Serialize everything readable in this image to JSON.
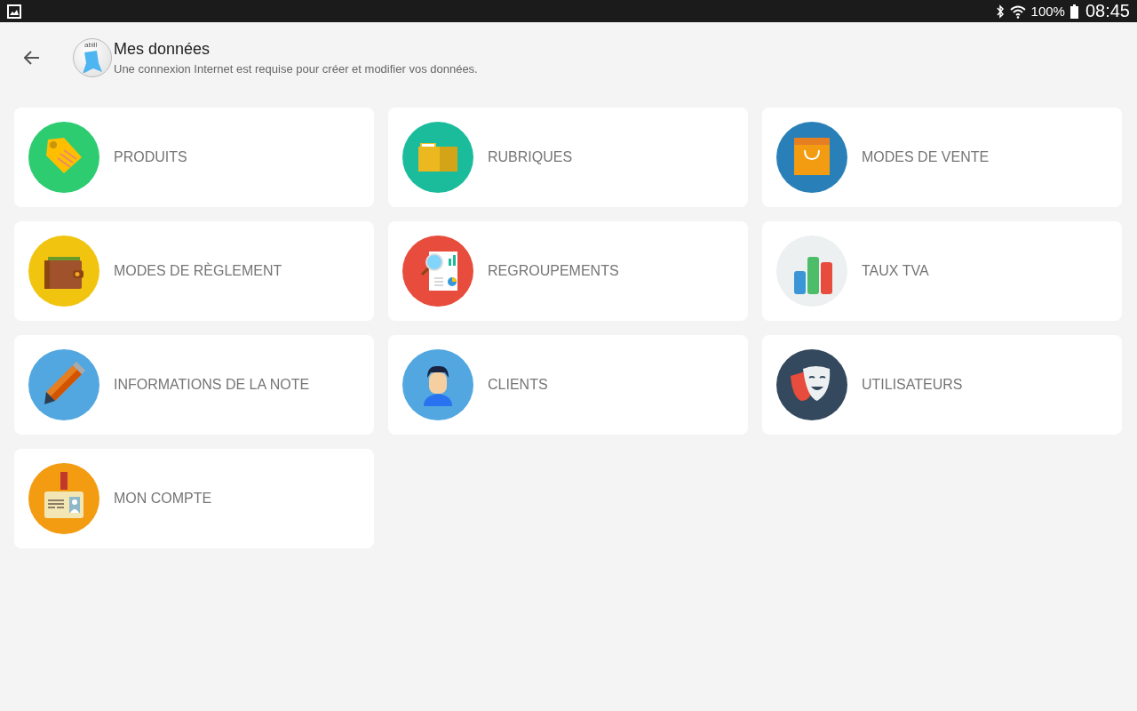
{
  "status_bar": {
    "battery": "100%",
    "time": "08:45"
  },
  "header": {
    "logo_text": "abill",
    "title": "Mes données",
    "subtitle": "Une connexion Internet est requise pour créer et modifier vos données."
  },
  "tiles": [
    {
      "label": "PRODUITS",
      "kind": "tag",
      "color": "#2ecc71"
    },
    {
      "label": "RUBRIQUES",
      "kind": "folder",
      "color": "#1abc9c"
    },
    {
      "label": "MODES DE VENTE",
      "kind": "bag",
      "color": "#2980b9"
    },
    {
      "label": "MODES DE RÈGLEMENT",
      "kind": "wallet",
      "color": "#f1c40f"
    },
    {
      "label": "REGROUPEMENTS",
      "kind": "report",
      "color": "#e74c3c"
    },
    {
      "label": "TAUX TVA",
      "kind": "bars",
      "color": "#ecf0f1"
    },
    {
      "label": "INFORMATIONS DE LA NOTE",
      "kind": "pencil",
      "color": "#52a7e0"
    },
    {
      "label": "CLIENTS",
      "kind": "person",
      "color": "#52a7e0"
    },
    {
      "label": "UTILISATEURS",
      "kind": "masks",
      "color": "#34495e"
    },
    {
      "label": "MON COMPTE",
      "kind": "badge",
      "color": "#f39c12"
    }
  ]
}
